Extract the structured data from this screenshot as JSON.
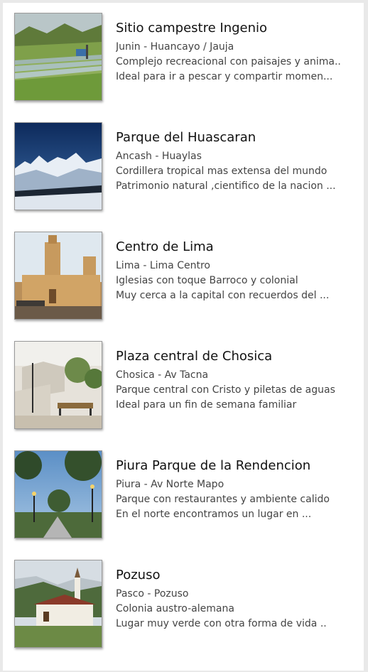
{
  "places": [
    {
      "title": "Sitio campestre Ingenio",
      "location": "Junin - Huancayo / Jauja",
      "line1": "Complejo recreacional con paisajes y anima..",
      "line2": "Ideal para ir a pescar y compartir momen...",
      "image": "trout-farm-landscape"
    },
    {
      "title": "Parque del Huascaran",
      "location": "Ancash - Huaylas",
      "line1": "Cordillera tropical mas extensa del mundo",
      "line2": "Patrimonio natural ,cientifico de la nacion ...",
      "image": "snowy-mountains"
    },
    {
      "title": "Centro de Lima",
      "location": "Lima - Lima Centro",
      "line1": "Iglesias con toque Barroco y colonial",
      "line2": "Muy cerca a la capital con recuerdos del ...",
      "image": "colonial-cathedral"
    },
    {
      "title": "Plaza central de Chosica",
      "location": "Chosica - Av Tacna",
      "line1": "Parque central con Cristo y piletas de aguas",
      "line2": "Ideal para un fin de semana familiar",
      "image": "park-stairs-bench"
    },
    {
      "title": "Piura Parque de la Rendencion",
      "location": "Piura - Av Norte Mapo",
      "line1": "Parque con restaurantes y ambiente calido",
      "line2": "En el norte encontramos un lugar en ...",
      "image": "evening-park-trees"
    },
    {
      "title": "Pozuso",
      "location": "Pasco - Pozuso",
      "line1": "Colonia austro-alemana",
      "line2": "Lugar muy verde con otra forma de vida ..",
      "image": "mountain-chapel"
    }
  ]
}
